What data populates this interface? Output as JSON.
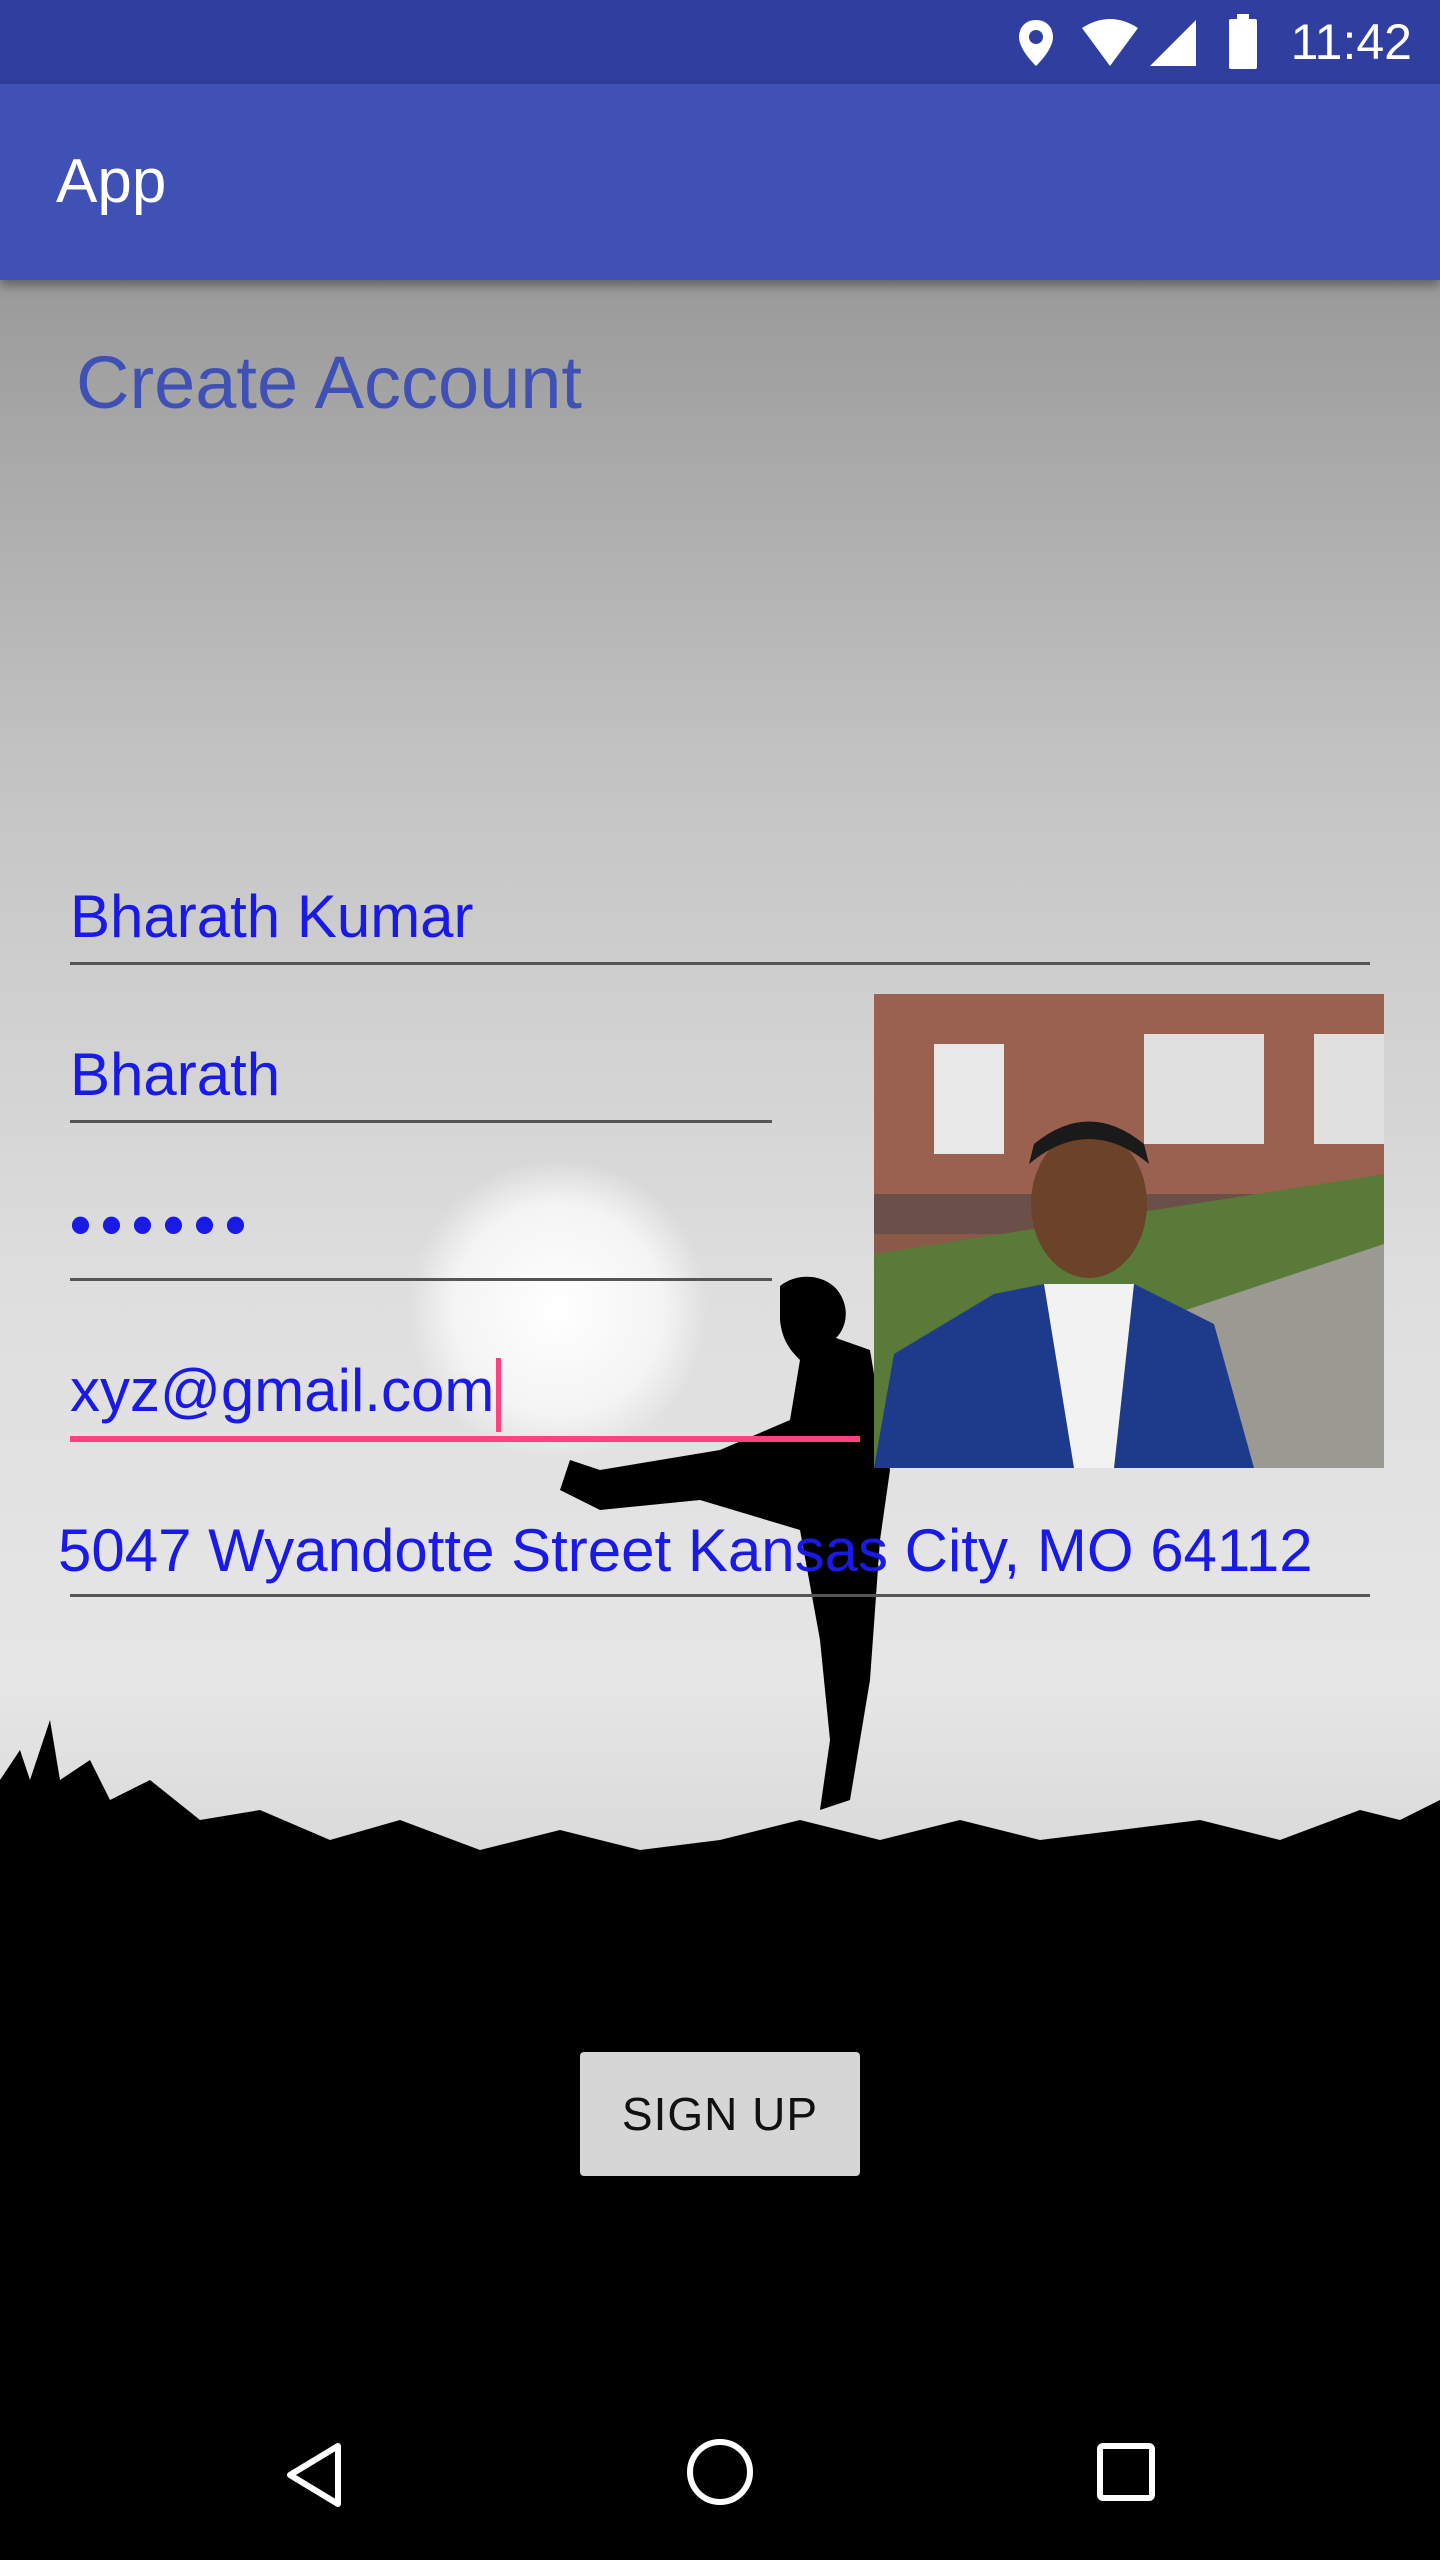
{
  "status_bar": {
    "time": "11:42",
    "icons": [
      "location-icon",
      "wifi-icon",
      "signal-icon",
      "battery-icon"
    ]
  },
  "app_bar": {
    "title": "App"
  },
  "form": {
    "heading": "Create Account",
    "full_name": "Bharath Kumar",
    "username": "Bharath",
    "password_mask": "••••••",
    "email": "xyz@gmail.com",
    "address": "5047 Wyandotte Street Kansas City, MO 64112",
    "submit_label": "SIGN UP"
  },
  "colors": {
    "status_bar": "#303F9F",
    "app_bar": "#3F51B5",
    "input_text": "#1A1AE6",
    "focus_underline": "#FF4081"
  },
  "nav_bar": {
    "icons": [
      "back-icon",
      "home-icon",
      "recents-icon"
    ]
  }
}
